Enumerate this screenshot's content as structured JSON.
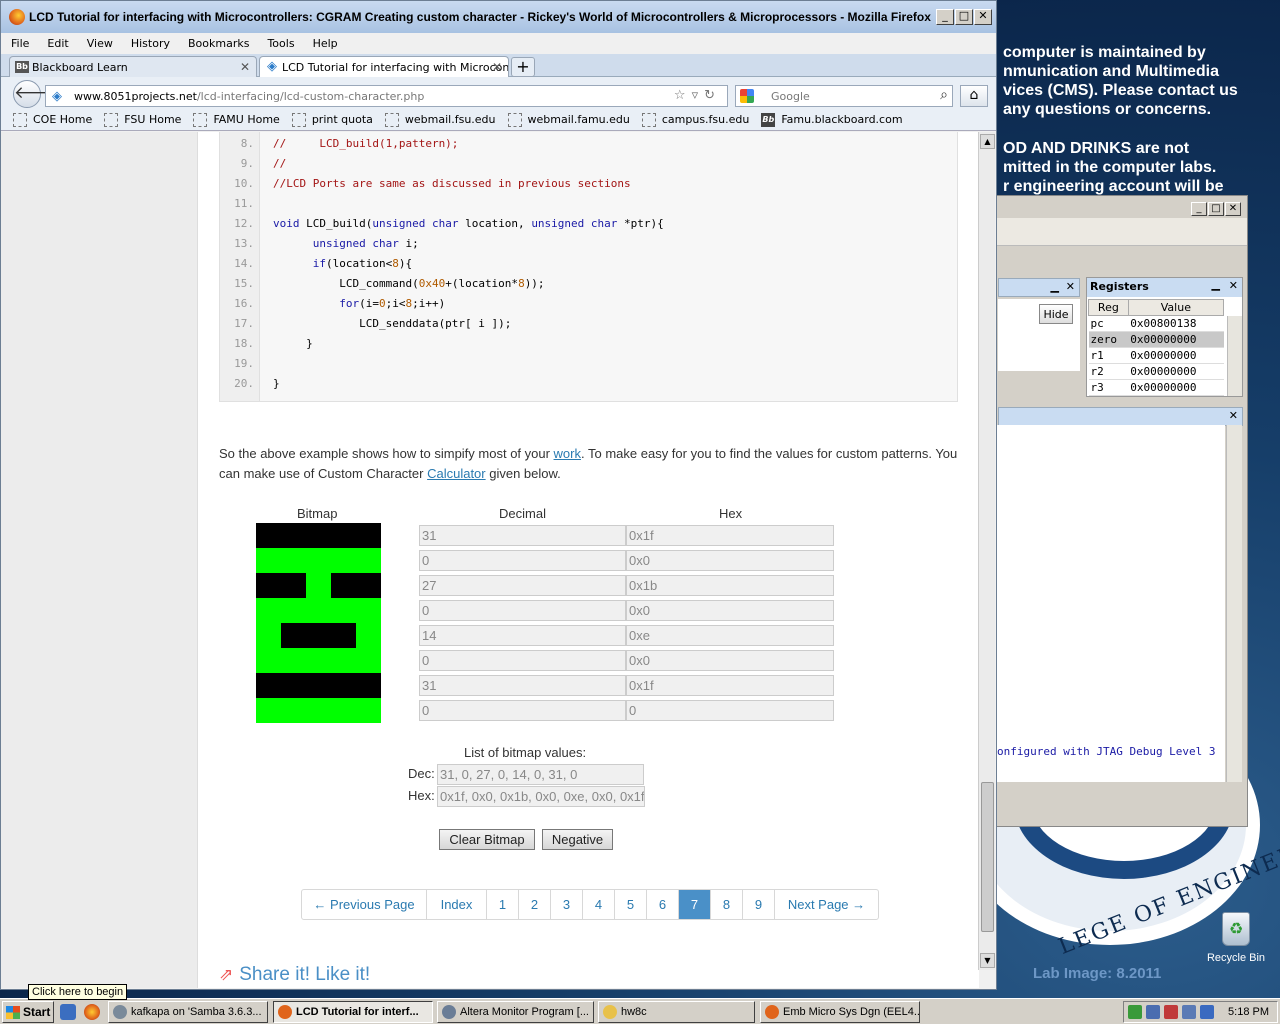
{
  "desktop": {
    "notice_lines": [
      " computer is maintained by",
      "nmunication and Multimedia",
      "vices (CMS). Please contact us",
      " any questions or concerns."
    ],
    "notice2_lines": [
      "OD AND DRINKS are not",
      "mitted in the computer labs.",
      "r engineering account will be"
    ],
    "seal_text": "LEGE OF ENGINEERING",
    "lab_image": "Lab Image: 8.2011",
    "recycle_bin": "Recycle Bin"
  },
  "altera": {
    "hide_button": "Hide",
    "registers": {
      "title": "Registers",
      "col_reg": "Reg",
      "col_value": "Value",
      "rows": [
        {
          "reg": "pc",
          "value": "0x00800138"
        },
        {
          "reg": "zero",
          "value": "0x00000000"
        },
        {
          "reg": "r1",
          "value": "0x00000000"
        },
        {
          "reg": "r2",
          "value": "0x00000000"
        },
        {
          "reg": "r3",
          "value": "0x00000000"
        }
      ]
    },
    "console_line": "onfigured with JTAG Debug Level 3"
  },
  "browser": {
    "title": "LCD Tutorial for interfacing with Microcontrollers: CGRAM Creating custom character - Rickey's World of Microcontrollers & Microprocessors - Mozilla Firefox",
    "menu": [
      "File",
      "Edit",
      "View",
      "History",
      "Bookmarks",
      "Tools",
      "Help"
    ],
    "tabs": [
      {
        "label": "Blackboard Learn",
        "active": false
      },
      {
        "label": "LCD Tutorial for interfacing with Microcon...",
        "active": true
      }
    ],
    "url_domain": "www.8051projects.net",
    "url_path": "/lcd-interfacing/lcd-custom-character.php",
    "search_placeholder": "Google",
    "bookmarks": [
      "COE Home",
      "FSU Home",
      "FAMU Home",
      "print quota",
      "webmail.fsu.edu",
      "webmail.famu.edu",
      "campus.fsu.edu",
      "Famu.blackboard.com"
    ]
  },
  "content": {
    "code_lines": [
      {
        "n": "8.",
        "html": "<span class='cm'>//     LCD_build(1,pattern);</span>"
      },
      {
        "n": "9.",
        "html": "<span class='cm'>//</span>"
      },
      {
        "n": "10.",
        "html": "<span class='cm'>//LCD Ports are same as discussed in previous sections</span>"
      },
      {
        "n": "11.",
        "html": ""
      },
      {
        "n": "12.",
        "html": "<span class='kw'>void</span> LCD_build(<span class='kw'>unsigned char</span> location, <span class='kw'>unsigned char</span> *ptr){"
      },
      {
        "n": "13.",
        "html": "      <span class='kw'>unsigned char</span> i;"
      },
      {
        "n": "14.",
        "html": "      <span class='kw'>if</span>(location&lt;<span class='num'>8</span>){"
      },
      {
        "n": "15.",
        "html": "          LCD_command(<span class='num'>0x40</span>+(location*<span class='num'>8</span>));"
      },
      {
        "n": "16.",
        "html": "          <span class='kw'>for</span>(i=<span class='num'>0</span>;i&lt;<span class='num'>8</span>;i++)"
      },
      {
        "n": "17.",
        "html": "             LCD_senddata(ptr[ i ]);"
      },
      {
        "n": "18.",
        "html": "     }"
      },
      {
        "n": "19.",
        "html": ""
      },
      {
        "n": "20.",
        "html": "}"
      }
    ],
    "para_1": "So the above example shows how to simpify most of your ",
    "para_link_1": "work",
    "para_2": ". To make easy for you to find the values for custom patterns. You can make use of Custom Character ",
    "para_link_2": "Calculator",
    "para_3": " given below.",
    "bitmap_label": "Bitmap",
    "decimal_label": "Decimal",
    "hex_label": "Hex",
    "bitmap_rows": [
      [
        1,
        1,
        1,
        1,
        1
      ],
      [
        0,
        0,
        0,
        0,
        0
      ],
      [
        1,
        1,
        0,
        1,
        1
      ],
      [
        0,
        0,
        0,
        0,
        0
      ],
      [
        0,
        1,
        1,
        1,
        0
      ],
      [
        0,
        0,
        0,
        0,
        0
      ],
      [
        1,
        1,
        1,
        1,
        1
      ],
      [
        0,
        0,
        0,
        0,
        0
      ]
    ],
    "colors": {
      "on": "#000000",
      "off": "#00ff00"
    },
    "values": [
      {
        "dec": "31",
        "hex": "0x1f"
      },
      {
        "dec": "0",
        "hex": "0x0"
      },
      {
        "dec": "27",
        "hex": "0x1b"
      },
      {
        "dec": "0",
        "hex": "0x0"
      },
      {
        "dec": "14",
        "hex": "0xe"
      },
      {
        "dec": "0",
        "hex": "0x0"
      },
      {
        "dec": "31",
        "hex": "0x1f"
      },
      {
        "dec": "0",
        "hex": "0"
      }
    ],
    "list_label": "List of bitmap values:",
    "dec_label": "Dec:",
    "hex_row_label": "Hex:",
    "dec_list": "31, 0, 27, 0, 14, 0, 31, 0",
    "hex_list": "0x1f, 0x0, 0x1b, 0x0, 0xe, 0x0, 0x1f, 0x0",
    "clear_button": "Clear Bitmap",
    "negative_button": "Negative",
    "pager": [
      "← Previous Page",
      "Index",
      "1",
      "2",
      "3",
      "4",
      "5",
      "6",
      "7",
      "8",
      "9",
      "Next Page →"
    ],
    "current_page": "7",
    "share": "Share it! Like it!"
  },
  "tooltip": "Click here to begin",
  "taskbar": {
    "start": "Start",
    "items": [
      {
        "label": "kafkapa on 'Samba 3.6.3...",
        "active": false
      },
      {
        "label": "LCD Tutorial for interf...",
        "active": true
      },
      {
        "label": "Altera Monitor Program [...",
        "active": false
      },
      {
        "label": "hw8c",
        "active": false
      },
      {
        "label": "Emb Micro Sys Dgn (EEL4...",
        "active": false
      }
    ],
    "clock": "5:18 PM"
  }
}
